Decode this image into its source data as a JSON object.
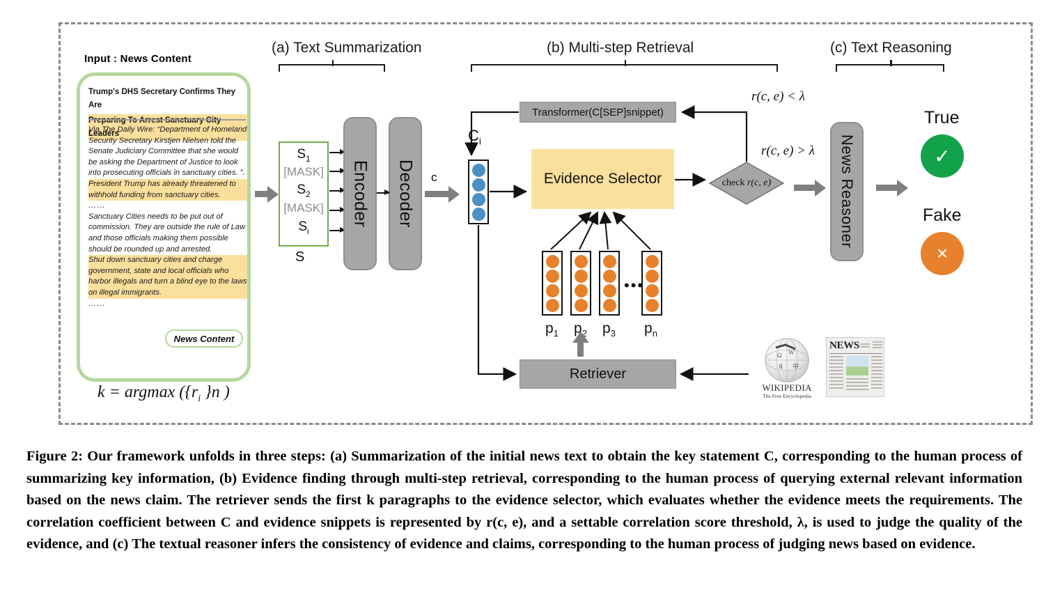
{
  "figure": {
    "input_title": "Input : News Content",
    "sections": [
      {
        "id": "a",
        "label": "(a) Text Summarization"
      },
      {
        "id": "b",
        "label": "(b) Multi-step Retrieval"
      },
      {
        "id": "c",
        "label": "(c) Text Reasoning"
      }
    ]
  },
  "news_card": {
    "headline_line1": "Trump's DHS Secretary Confirms They Are",
    "headline_line2": "Preparing To Arrest Sanctuary City Leaders",
    "paragraph1": "Via The Daily Wire: “Department of Homeland Security Secretary Kirstjen Nielsen told the Senate Judiciary Committee that she would be asking the Department of Justice to look into prosecuting officials in sanctuary cities. ”.",
    "paragraph2_highlighted": "President Trump has already threatened to withhold funding from sanctuary cities.",
    "ellipsis1": "……",
    "paragraph3": "Sanctuary Cities needs to be put out of commission. They are outside the rule of Law and those officials making them possible should be rounded up and arrested.",
    "paragraph4_highlighted": "Shut down sanctuary cities and charge government, state and local officials who harbor illegals and turn a blind eye to the laws on illegal immigrants.",
    "ellipsis2": "……",
    "chip_label": "News Content"
  },
  "formula": {
    "argmax": "k = argmax ({r i }n )",
    "argmax_lhs": "k = ",
    "argmax_fn": "argmax",
    "argmax_args_open": " ({r",
    "argmax_sub": "i",
    "argmax_args_close": " }n )"
  },
  "summarization": {
    "s_box_lines": [
      "S₁",
      "[MASK]",
      "S₂",
      "[MASK]",
      "Sᵢ"
    ],
    "s_items": [
      {
        "text": "S",
        "sub": "1",
        "mask": false
      },
      {
        "text": "[MASK]",
        "sub": "",
        "mask": true
      },
      {
        "text": "S",
        "sub": "2",
        "mask": false
      },
      {
        "text": "[MASK]",
        "sub": "",
        "mask": true
      },
      {
        "text": "S",
        "sub": "i",
        "mask": false
      }
    ],
    "s_label": "S",
    "encoder_label": "Encoder",
    "decoder_label": "Decoder",
    "c_label": "c"
  },
  "retrieval": {
    "ci_label": "C",
    "ci_sub": "i",
    "transformer_label": "Transformer(C[SEP]snippet)",
    "evidence_selector_label": "Evidence Selector",
    "retriever_label": "Retriever",
    "check_label": "check",
    "check_expr": "r(c, e)",
    "branch_fail": "r(c, e) < λ",
    "branch_pass": "r(c, e) > λ",
    "paragraph_labels": [
      {
        "text": "p",
        "sub": "1"
      },
      {
        "text": "p",
        "sub": "2"
      },
      {
        "text": "p",
        "sub": "3"
      },
      {
        "text": "p",
        "sub": "n"
      }
    ],
    "paragraph_ellipsis": "•••",
    "sources": {
      "wikipedia_name": "WIKIPEDIA",
      "wikipedia_tagline": "The Free Encyclopedia",
      "news_name": "NEWS"
    }
  },
  "reasoning": {
    "news_reasoner_label": "News Reasoner",
    "results": [
      {
        "label": "True",
        "glyph": "✓",
        "color": "#12a24a"
      },
      {
        "label": "Fake",
        "glyph": "×",
        "color": "#e8812c"
      }
    ]
  },
  "caption": {
    "text": "Figure 2: Our framework unfolds in three steps: (a) Summarization of the initial news text to obtain the key statement C, corresponding to the human process of summarizing key information, (b) Evidence finding through multi-step retrieval, corresponding to the human process of querying external relevant information based on the news claim. The retriever sends the first k paragraphs to the evidence selector, which evaluates whether the evidence meets the requirements. The correlation coefficient between C and evidence snippets is represented by r(c, e), and a settable correlation score threshold, λ, is used to judge the quality of the evidence, and (c) The textual reasoner infers the consistency of evidence and claims, corresponding to the human process of judging news based on evidence."
  },
  "colors": {
    "card_border_green": "#b4d79e",
    "highlight_yellow": "#fbdf9d",
    "s_box_green": "#70ad47",
    "gray_box": "#a6a6a6",
    "gray_arrow": "#7f7f7f",
    "dot_blue": "#4a90c4",
    "dot_orange": "#e8812c",
    "true_green": "#12a24a",
    "fake_orange": "#e8812c",
    "frame_dashed": "#8a8a8a"
  }
}
